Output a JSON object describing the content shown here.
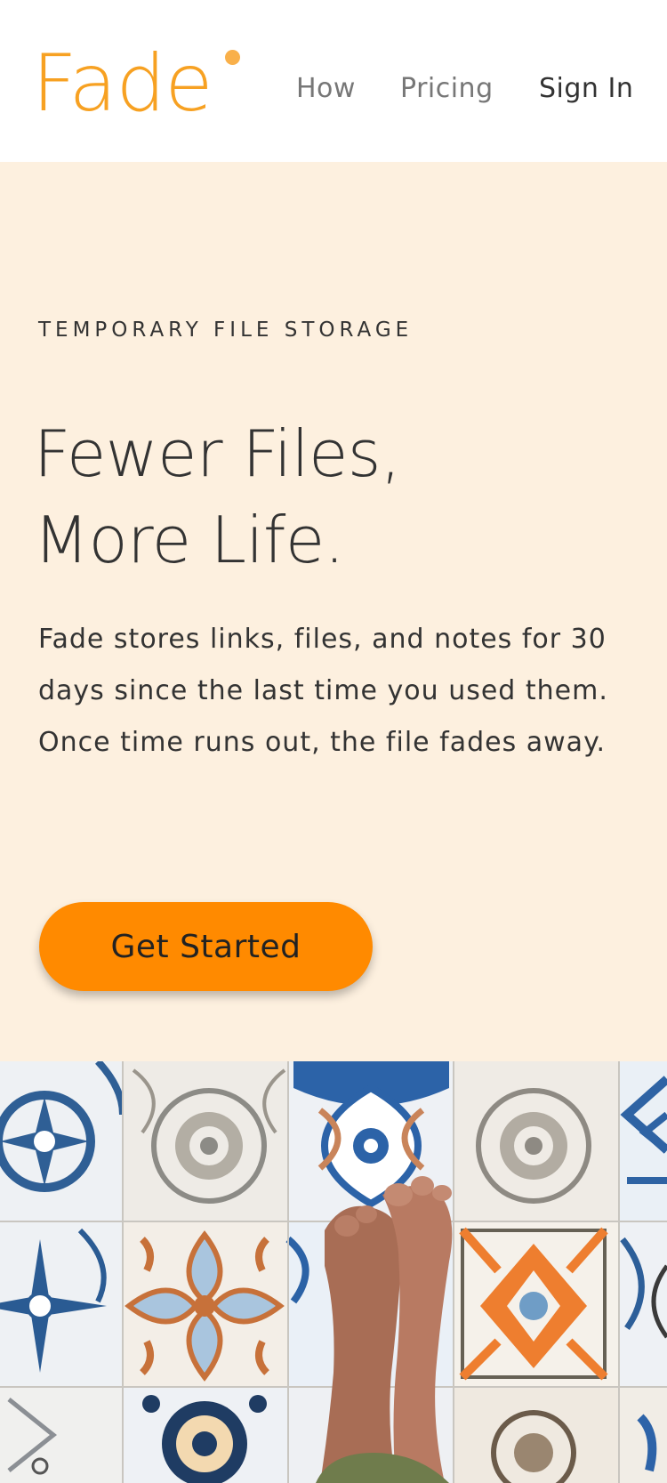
{
  "header": {
    "logo_text": "Fade",
    "nav": {
      "how": "How",
      "pricing": "Pricing",
      "sign_in": "Sign In"
    }
  },
  "hero": {
    "eyebrow": "TEMPORARY FILE STORAGE",
    "headline_line1": "Fewer Files,",
    "headline_line2": "More Life.",
    "description": "Fade stores links, files, and notes for 30 days since the last time you used them. Once time runs out, the file fades away.",
    "cta_label": "Get Started"
  },
  "colors": {
    "brand_orange": "#f7a122",
    "cta_orange": "#ff8a00",
    "hero_background": "#fdf0df",
    "text_dark": "#333333",
    "nav_gray": "#777777"
  }
}
